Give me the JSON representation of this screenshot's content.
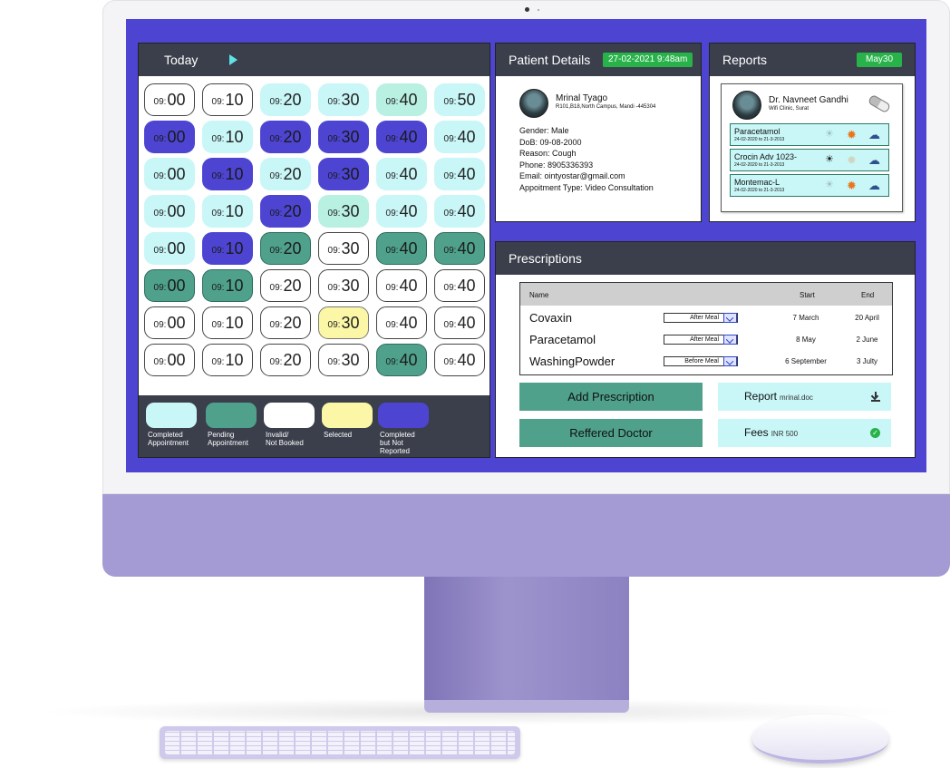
{
  "schedule": {
    "title": "Today",
    "slots": [
      [
        {
          "p": "09:",
          "t": "00",
          "s": "invalid"
        },
        {
          "p": "09:",
          "t": "10",
          "s": "invalid"
        },
        {
          "p": "09:",
          "t": "20",
          "s": "completed"
        },
        {
          "p": "09:",
          "t": "30",
          "s": "completed"
        },
        {
          "p": "09:",
          "t": "40",
          "s": "mint"
        },
        {
          "p": "09:",
          "t": "50",
          "s": "completed"
        }
      ],
      [
        {
          "p": "09:",
          "t": "00",
          "s": "reported"
        },
        {
          "p": "09:",
          "t": "10",
          "s": "completed"
        },
        {
          "p": "09:",
          "t": "20",
          "s": "reported"
        },
        {
          "p": "09:",
          "t": "30",
          "s": "reported"
        },
        {
          "p": "09:",
          "t": "40",
          "s": "reported"
        },
        {
          "p": "09:",
          "t": "40",
          "s": "completed"
        }
      ],
      [
        {
          "p": "09:",
          "t": "00",
          "s": "completed"
        },
        {
          "p": "09:",
          "t": "10",
          "s": "reported"
        },
        {
          "p": "09:",
          "t": "20",
          "s": "completed"
        },
        {
          "p": "09:",
          "t": "30",
          "s": "reported"
        },
        {
          "p": "09:",
          "t": "40",
          "s": "completed"
        },
        {
          "p": "09:",
          "t": "40",
          "s": "completed"
        }
      ],
      [
        {
          "p": "09:",
          "t": "00",
          "s": "completed"
        },
        {
          "p": "09:",
          "t": "10",
          "s": "completed"
        },
        {
          "p": "09:",
          "t": "20",
          "s": "reported"
        },
        {
          "p": "09:",
          "t": "30",
          "s": "mint"
        },
        {
          "p": "09:",
          "t": "40",
          "s": "completed"
        },
        {
          "p": "09:",
          "t": "40",
          "s": "completed"
        }
      ],
      [
        {
          "p": "09:",
          "t": "00",
          "s": "completed"
        },
        {
          "p": "09:",
          "t": "10",
          "s": "reported"
        },
        {
          "p": "09:",
          "t": "20",
          "s": "pending"
        },
        {
          "p": "09:",
          "t": "30",
          "s": "invalid"
        },
        {
          "p": "09:",
          "t": "40",
          "s": "pending"
        },
        {
          "p": "09:",
          "t": "40",
          "s": "pending"
        }
      ],
      [
        {
          "p": "09:",
          "t": "00",
          "s": "pending"
        },
        {
          "p": "09:",
          "t": "10",
          "s": "pending"
        },
        {
          "p": "09:",
          "t": "20",
          "s": "invalid"
        },
        {
          "p": "09:",
          "t": "30",
          "s": "invalid"
        },
        {
          "p": "09:",
          "t": "40",
          "s": "invalid"
        },
        {
          "p": "09:",
          "t": "40",
          "s": "invalid"
        }
      ],
      [
        {
          "p": "09:",
          "t": "00",
          "s": "invalid"
        },
        {
          "p": "09:",
          "t": "10",
          "s": "invalid"
        },
        {
          "p": "09:",
          "t": "20",
          "s": "invalid"
        },
        {
          "p": "09:",
          "t": "30",
          "s": "selected"
        },
        {
          "p": "09:",
          "t": "40",
          "s": "invalid"
        },
        {
          "p": "09:",
          "t": "40",
          "s": "invalid"
        }
      ],
      [
        {
          "p": "09:",
          "t": "00",
          "s": "invalid"
        },
        {
          "p": "09:",
          "t": "10",
          "s": "invalid"
        },
        {
          "p": "09:",
          "t": "20",
          "s": "invalid"
        },
        {
          "p": "09:",
          "t": "30",
          "s": "invalid"
        },
        {
          "p": "09:",
          "t": "40",
          "s": "pending"
        },
        {
          "p": "09:",
          "t": "40",
          "s": "invalid"
        }
      ]
    ],
    "legend": [
      {
        "label1": "Completed",
        "label2": "Appointment",
        "color": "#c9f6f7"
      },
      {
        "label1": "Pending",
        "label2": "Appointment",
        "color": "#4fa18b"
      },
      {
        "label1": "Invalid/",
        "label2": "Not Booked",
        "color": "#ffffff"
      },
      {
        "label1": "Selected",
        "label2": "",
        "color": "#fbf7a6"
      },
      {
        "label1": "Completed",
        "label2": "but Not Reported",
        "color": "#4d45d2"
      }
    ]
  },
  "patient": {
    "title": "Patient Details",
    "datetime": "27-02-2021  9:48am",
    "name": "Mrinal Tyago",
    "address": "R101,B18,North Campus, Mandi -445304",
    "gender": "Gender: Male",
    "dob": "DoB: 09-08-2000",
    "reason": "Reason: Cough",
    "phone": "Phone: 8905336393",
    "email": "Email: ointyostar@gmail.com",
    "appointment_type": "Appoitment Type: Video Consultation"
  },
  "reports": {
    "title": "Reports",
    "badge": "May30",
    "doctor_name": "Dr. Navneet Gandhi",
    "clinic": "Wifi Clinic, Surat",
    "medicines": [
      {
        "name": "Paracetamol",
        "dates": "24-02-2020 to 21-3-2013",
        "morning": false,
        "noon": true,
        "night": true
      },
      {
        "name": "Crocin Adv 1023-",
        "dates": "24-02-2020 to 21-3-2013",
        "morning": true,
        "noon": false,
        "night": true
      },
      {
        "name": "Montemac-L",
        "dates": "24-02-2020 to 21-3-2013",
        "morning": false,
        "noon": true,
        "night": true
      }
    ]
  },
  "prescriptions": {
    "title": "Prescriptions",
    "headers": {
      "name": "Name",
      "start": "Start",
      "end": "End"
    },
    "rows": [
      {
        "name": "Covaxin",
        "timing": "After Meal",
        "start": "7 March",
        "end": "20 April"
      },
      {
        "name": "Paracetamol",
        "timing": "After Meal",
        "start": "8 May",
        "end": "2 June"
      },
      {
        "name": "WashingPowder",
        "timing": "Before Meal",
        "start": "6 September",
        "end": "3 Julty"
      }
    ],
    "add_button": "Add Prescription",
    "referred_button": "Reffered Doctor",
    "report_label": "Report",
    "report_file": "mrinal.doc",
    "fees_label": "Fees",
    "fees_value": "INR 500"
  },
  "colors": {
    "screen_bg": "#4d45d2",
    "header_bg": "#3a3f4b",
    "completed": "#c9f6f7",
    "pending": "#4fa18b",
    "selected": "#fbf7a6",
    "reported": "#4d45d2",
    "badge_green": "#28b34a"
  }
}
